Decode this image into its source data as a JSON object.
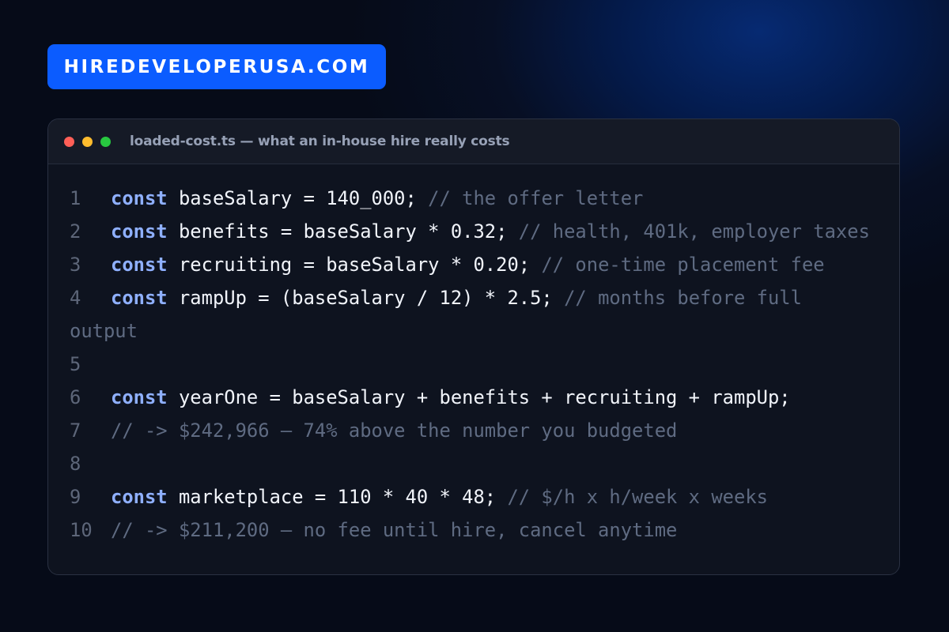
{
  "brand": {
    "label": "HIREDEVELOPERUSA.COM",
    "color": "#0b5cff"
  },
  "window": {
    "title": "loaded-cost.ts — what an in-house hire really costs",
    "controls": [
      {
        "name": "close",
        "color": "#ff5f57"
      },
      {
        "name": "minimize",
        "color": "#febc2e"
      },
      {
        "name": "maximize",
        "color": "#28c840"
      }
    ]
  },
  "code": {
    "keyword_color": "#8fb0ff",
    "comment_color": "#5f6b82",
    "lines": [
      {
        "n": "1",
        "kw": "const",
        "code": " baseSalary = 140_000; ",
        "comment": "// the offer letter"
      },
      {
        "n": "2",
        "kw": "const",
        "code": " benefits = baseSalary * 0.32; ",
        "comment": "// health, 401k, employer taxes"
      },
      {
        "n": "3",
        "kw": "const",
        "code": " recruiting = baseSalary * 0.20; ",
        "comment": "// one-time placement fee"
      },
      {
        "n": "4",
        "kw": "const",
        "code": " rampUp = (baseSalary / 12) * 2.5; ",
        "comment": "// months before full"
      },
      {
        "n": "",
        "kw": "",
        "code": "",
        "comment": "output"
      },
      {
        "n": "5",
        "kw": "",
        "code": "",
        "comment": ""
      },
      {
        "n": "6",
        "kw": "const",
        "code": " yearOne = baseSalary + benefits + recruiting + rampUp;",
        "comment": ""
      },
      {
        "n": "7",
        "kw": "",
        "code": "",
        "comment": "// -> $242,966 — 74% above the number you budgeted"
      },
      {
        "n": "8",
        "kw": "",
        "code": "",
        "comment": ""
      },
      {
        "n": "9",
        "kw": "const",
        "code": " marketplace = 110 * 40 * 48; ",
        "comment": "// $/h x h/week x weeks"
      },
      {
        "n": "10",
        "kw": "",
        "code": "",
        "comment": "// -> $211,200 — no fee until hire, cancel anytime"
      }
    ]
  }
}
